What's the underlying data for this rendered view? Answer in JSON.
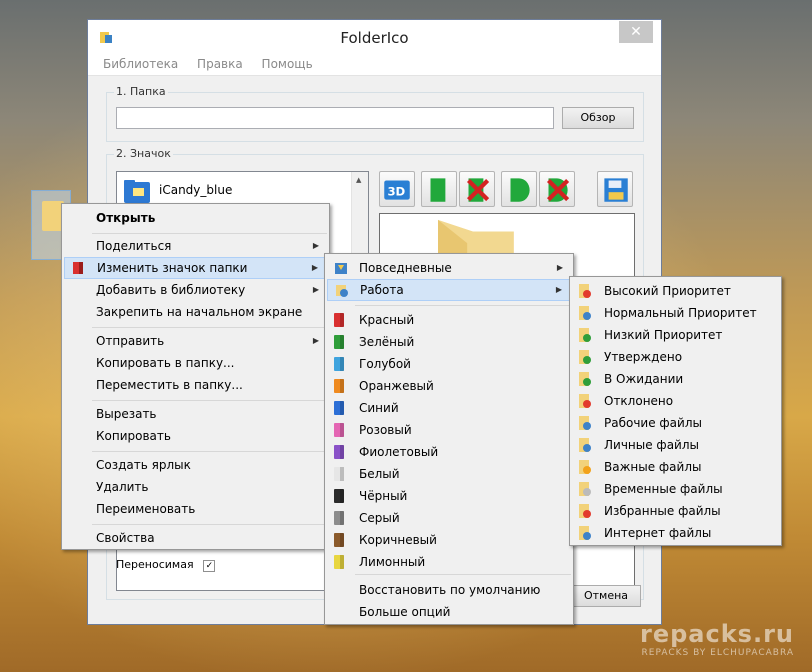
{
  "window": {
    "title": "FolderIco",
    "menu": [
      "Библиотека",
      "Правка",
      "Помощь"
    ],
    "group1_label": "1. Папка",
    "folder_path": "",
    "browse_button": "Обзор",
    "group2_label": "2. Значок",
    "icon_list": [
      {
        "name": "iCandy_blue",
        "icon": "icandy-blue-folder-icon"
      }
    ],
    "portable_label": "Переносимая",
    "portable_checked": true,
    "cancel_button": "Отмена"
  },
  "context_menu": {
    "items": [
      {
        "label": "Открыть",
        "bold": true
      },
      {
        "label": "Поделиться",
        "submenu": true
      },
      {
        "label": "Изменить значок папки",
        "submenu": true,
        "highlighted": true,
        "icon": "folderico-icon"
      },
      {
        "label": "Добавить в библиотеку",
        "submenu": true
      },
      {
        "label": "Закрепить на начальном экране"
      },
      {
        "label": "Отправить",
        "submenu": true
      },
      {
        "label": "Копировать в папку..."
      },
      {
        "label": "Переместить в папку..."
      },
      {
        "label": "Вырезать"
      },
      {
        "label": "Копировать"
      },
      {
        "label": "Создать ярлык"
      },
      {
        "label": "Удалить"
      },
      {
        "label": "Переименовать"
      },
      {
        "label": "Свойства"
      }
    ]
  },
  "submenu_colors": {
    "items": [
      {
        "label": "Повседневные",
        "submenu": true,
        "icon": "everyday-folder-icon"
      },
      {
        "label": "Работа",
        "submenu": true,
        "highlighted": true,
        "icon": "work-folder-icon"
      },
      {
        "label": "Красный",
        "color": "#d93030"
      },
      {
        "label": "Зелёный",
        "color": "#2f9e3a"
      },
      {
        "label": "Голубой",
        "color": "#3fa4de"
      },
      {
        "label": "Оранжевый",
        "color": "#ef8a1f"
      },
      {
        "label": "Синий",
        "color": "#2d6fd6"
      },
      {
        "label": "Розовый",
        "color": "#e466b3"
      },
      {
        "label": "Фиолетовый",
        "color": "#8a52c8"
      },
      {
        "label": "Белый",
        "color": "#e6e6e6"
      },
      {
        "label": "Чёрный",
        "color": "#2b2b2b"
      },
      {
        "label": "Серый",
        "color": "#8c8c8c"
      },
      {
        "label": "Коричневый",
        "color": "#8b5a2b"
      },
      {
        "label": "Лимонный",
        "color": "#e8d640"
      },
      {
        "label": "Восстановить по умолчанию"
      },
      {
        "label": "Больше опций"
      }
    ]
  },
  "submenu_work": {
    "items": [
      {
        "label": "Высокий Приоритет",
        "icon": "high-priority-icon"
      },
      {
        "label": "Нормальный Приоритет",
        "icon": "normal-priority-icon"
      },
      {
        "label": "Низкий Приоритет",
        "icon": "low-priority-icon"
      },
      {
        "label": "Утверждено",
        "icon": "approved-icon"
      },
      {
        "label": "В Ожидании",
        "icon": "pending-icon"
      },
      {
        "label": "Отклонено",
        "icon": "rejected-icon"
      },
      {
        "label": "Рабочие файлы",
        "icon": "work-files-icon"
      },
      {
        "label": "Личные файлы",
        "icon": "personal-files-icon"
      },
      {
        "label": "Важные файлы",
        "icon": "important-files-icon"
      },
      {
        "label": "Временные файлы",
        "icon": "temp-files-icon"
      },
      {
        "label": "Избранные файлы",
        "icon": "favorite-files-icon"
      },
      {
        "label": "Интернет файлы",
        "icon": "internet-files-icon"
      }
    ]
  },
  "watermark": {
    "main": "repacks.ru",
    "sub": "REPACKS BY ELCHUPACABRA"
  }
}
